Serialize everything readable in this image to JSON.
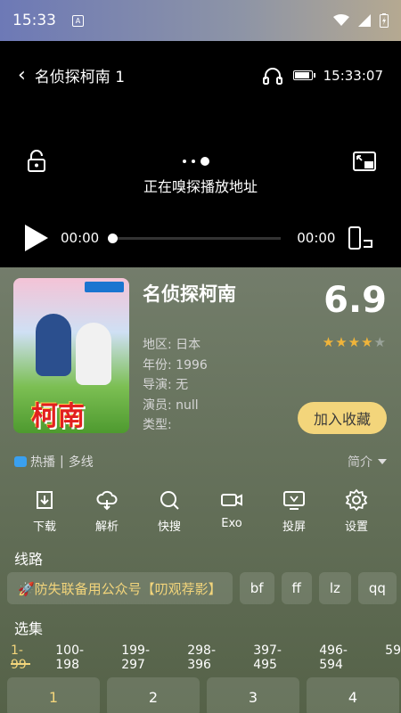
{
  "status_bar": {
    "time": "15:33",
    "notif_glyph": "A"
  },
  "player": {
    "back_glyph": "‹",
    "title": "名侦探柯南 1",
    "clock": "15:33:07",
    "loading_text": "正在嗅探播放地址",
    "current_time": "00:00",
    "total_time": "00:00",
    "progress": 0
  },
  "detail": {
    "title": "名侦探柯南",
    "rating": "6.9",
    "stars": 3.5,
    "meta": [
      "地区: 日本",
      "年份: 1996",
      "导演: 无",
      "演员: null",
      "类型:"
    ],
    "favorite_label": "加入收藏",
    "poster_text": "柯南"
  },
  "tags": {
    "hot": "热播",
    "sep": "|",
    "multi": "多线",
    "intro": "简介"
  },
  "actions": [
    {
      "label": "下载",
      "icon": "download-icon"
    },
    {
      "label": "解析",
      "icon": "cloud-parse-icon"
    },
    {
      "label": "快搜",
      "icon": "search-icon"
    },
    {
      "label": "Exo",
      "icon": "video-camera-icon"
    },
    {
      "label": "投屏",
      "icon": "tv-cast-icon"
    },
    {
      "label": "设置",
      "icon": "gear-icon"
    }
  ],
  "lines_label": "线路",
  "lines": [
    "🚀防失联备用公众号【叨观荐影】",
    "bf",
    "ff",
    "lz",
    "qq"
  ],
  "episodes_label": "选集",
  "ranges": [
    "1-99",
    "100-198",
    "199-297",
    "298-396",
    "397-495",
    "496-594",
    "59"
  ],
  "episodes": [
    "1",
    "2",
    "3",
    "4"
  ],
  "colors": {
    "accent": "#f3d57b",
    "star": "#f0b43a"
  }
}
